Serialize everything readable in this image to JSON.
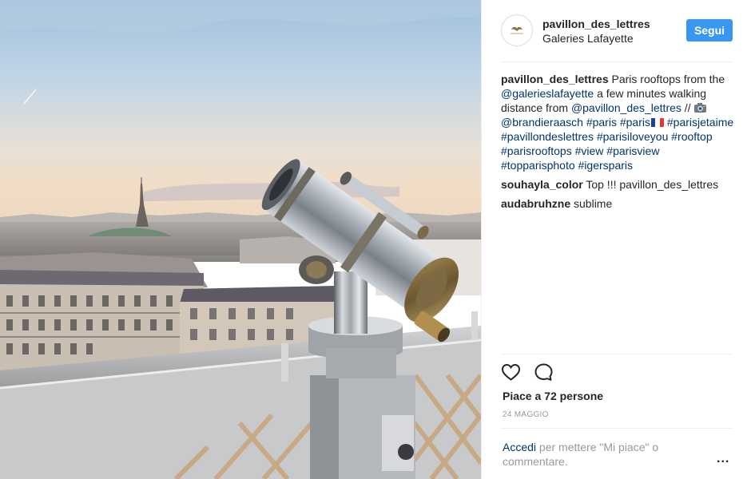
{
  "post": {
    "author": "pavillon_des_lettres",
    "location": "Galleries Lafayette",
    "follow_label": "Segui",
    "caption": {
      "user": "pavillon_des_lettres",
      "text_1": "Paris rooftops from the",
      "mention_1": "@galerieslafayette",
      "text_2": "a few minutes walking distance from",
      "mention_2": "@pavillon_des_lettres",
      "text_3": "//",
      "mention_3": "@brandieraasch",
      "hashtags": [
        "#paris",
        "#paris",
        "#parisjetaime",
        "#pavillondeslettres",
        "#parisiloveyou",
        "#rooftop",
        "#parisrooftops",
        "#view",
        "#parisview",
        "#topparisphoto",
        "#igersparis"
      ]
    },
    "comments": [
      {
        "user": "souhayla_color",
        "text": "Top !!! pavillon_des_lettres"
      },
      {
        "user": "audabruhzne",
        "text": "sublime"
      }
    ],
    "likes_text": "Piace a 72 persone",
    "date": "24 MAGGIO",
    "login_link": "Accedi",
    "login_text": "per mettere \"Mi piace\" o commentare.",
    "more_label": "..."
  },
  "icons": {
    "like": "heart-icon",
    "comment": "comment-icon",
    "camera": "camera-emoji-icon",
    "flag": "france-flag-icon"
  },
  "colors": {
    "follow_button": "#3897f0",
    "link": "#003569",
    "muted": "#999999"
  }
}
